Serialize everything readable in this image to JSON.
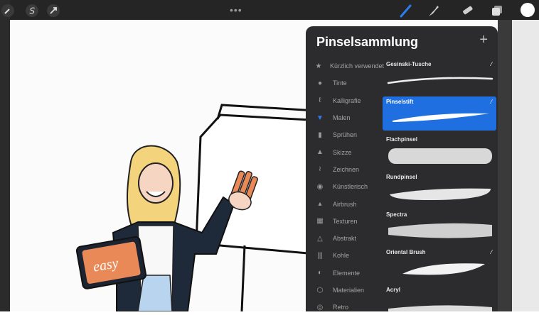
{
  "panel": {
    "title": "Pinselsammlung",
    "add_symbol": "+"
  },
  "toolbar": {
    "dots": "•••",
    "tools": [
      "brush-icon",
      "smudge-icon",
      "eraser-icon",
      "layers-icon"
    ],
    "left_tools": [
      "wrench-icon",
      "selection-s-icon",
      "arrow-icon"
    ],
    "color": "#ffffff"
  },
  "categories": [
    {
      "label": "Kürzlich verwendet",
      "icon": "star-icon"
    },
    {
      "label": "Tinte",
      "icon": "ink-drop-icon"
    },
    {
      "label": "Kalligrafie",
      "icon": "calligraphy-icon"
    },
    {
      "label": "Malen",
      "icon": "paint-icon"
    },
    {
      "label": "Sprühen",
      "icon": "spray-icon"
    },
    {
      "label": "Skizze",
      "icon": "pencil-icon"
    },
    {
      "label": "Zeichnen",
      "icon": "draw-icon"
    },
    {
      "label": "Künstlerisch",
      "icon": "palette-icon"
    },
    {
      "label": "Airbrush",
      "icon": "airbrush-icon"
    },
    {
      "label": "Texturen",
      "icon": "texture-icon"
    },
    {
      "label": "Abstrakt",
      "icon": "triangle-icon"
    },
    {
      "label": "Kohle",
      "icon": "charcoal-icon"
    },
    {
      "label": "Elemente",
      "icon": "elements-icon"
    },
    {
      "label": "Materialien",
      "icon": "cube-icon"
    },
    {
      "label": "Retro",
      "icon": "retro-icon"
    }
  ],
  "brushes": [
    {
      "name": "Gesinski-Tusche"
    },
    {
      "name": "Pinselstift"
    },
    {
      "name": "Flachpinsel"
    },
    {
      "name": "Rundpinsel"
    },
    {
      "name": "Spectra"
    },
    {
      "name": "Oriental Brush"
    },
    {
      "name": "Acryl"
    }
  ],
  "colors": {
    "accent": "#1f6fe0",
    "panel": "#2c2c2e"
  }
}
